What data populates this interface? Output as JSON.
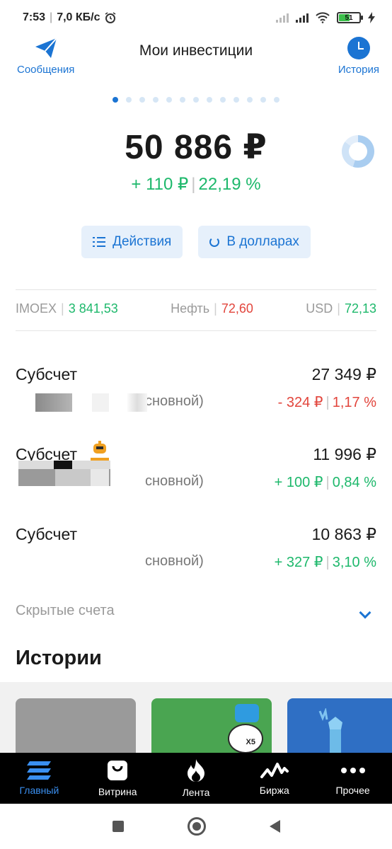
{
  "status_bar": {
    "time": "7:53",
    "net_speed": "7,0 КБ/с",
    "battery": "51"
  },
  "header": {
    "title": "Мои инвестиции",
    "messages_label": "Сообщения",
    "history_label": "История"
  },
  "pager": {
    "count": 13,
    "active_index": 0
  },
  "balance": {
    "total": "50 886 ₽",
    "change_abs": "+ 110 ₽",
    "change_pct": "22,19 %"
  },
  "actions": {
    "actions_label": "Действия",
    "dollars_label": "В долларах"
  },
  "indices": [
    {
      "name": "IMOEX",
      "value": "3 841,53",
      "color": "#1db86b"
    },
    {
      "name": "Нефть",
      "value": "72,60",
      "color": "#e2453c"
    },
    {
      "name": "USD",
      "value": "72,13",
      "color": "#1db86b"
    }
  ],
  "accounts": [
    {
      "name": "Субсчет",
      "sub": "сновной)",
      "value": "27 349 ₽",
      "change_abs": "- 324 ₽",
      "change_pct": "1,17 %",
      "trend": "down"
    },
    {
      "name": "Субсчет",
      "sub": "сновной)",
      "value": "11 996 ₽",
      "change_abs": "+ 100 ₽",
      "change_pct": "0,84 %",
      "trend": "up"
    },
    {
      "name": "Субсчет",
      "sub": "сновной)",
      "value": "10 863 ₽",
      "change_abs": "+ 327 ₽",
      "change_pct": "3,10 %",
      "trend": "up"
    }
  ],
  "hidden_accounts_label": "Скрытые счета",
  "stories_title": "Истории",
  "story_badge": "X5",
  "tabs": [
    {
      "label": "Главный",
      "icon": "home-stack-icon",
      "active": true
    },
    {
      "label": "Витрина",
      "icon": "shopping-bag-icon",
      "active": false
    },
    {
      "label": "Лента",
      "icon": "flame-icon",
      "active": false
    },
    {
      "label": "Биржа",
      "icon": "pulse-chart-icon",
      "active": false
    },
    {
      "label": "Прочее",
      "icon": "more-dots-icon",
      "active": false
    }
  ],
  "colors": {
    "accent": "#1b74d3",
    "positive": "#1db86b",
    "negative": "#e2453c",
    "tab_active": "#3a8ff0"
  }
}
